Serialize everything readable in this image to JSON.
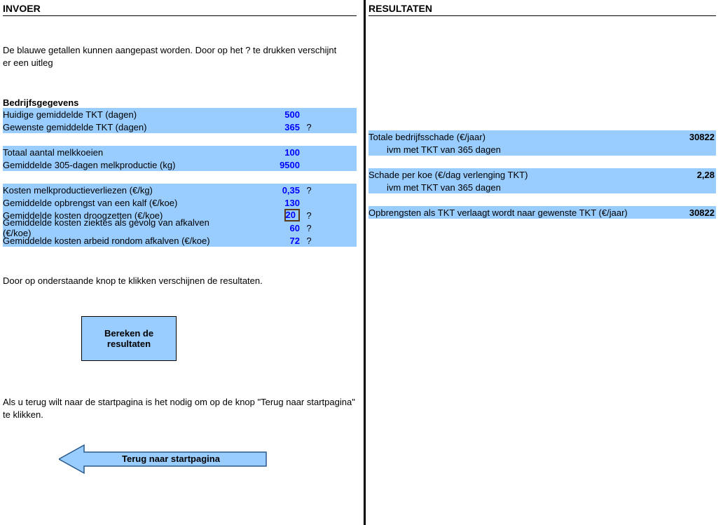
{
  "left": {
    "header": "INVOER",
    "intro": "De blauwe getallen kunnen aangepast worden. Door op het ? te drukken verschijnt er een uitleg",
    "section_title": "Bedrijfsgegevens",
    "rows": [
      {
        "label": "Huidige gemiddelde TKT (dagen)",
        "value": "500",
        "help": ""
      },
      {
        "label": "Gewenste gemiddelde TKT (dagen)",
        "value": "365",
        "help": "?"
      },
      {
        "label": "Totaal aantal melkkoeien",
        "value": "100",
        "help": ""
      },
      {
        "label": "Gemiddelde 305-dagen melkproductie (kg)",
        "value": "9500",
        "help": ""
      },
      {
        "label": "Kosten melkproductieverliezen (€/kg)",
        "value": "0,35",
        "help": "?"
      },
      {
        "label": "Gemiddelde opbrengst van een kalf (€/koe)",
        "value": "130",
        "help": ""
      },
      {
        "label": "Gemiddelde kosten droogzetten (€/koe)",
        "value": "20",
        "help": "?"
      },
      {
        "label": "Gemiddelde kosten ziektes als gevolg van afkalven (€/koe)",
        "value": "60",
        "help": "?"
      },
      {
        "label": "Gemiddelde kosten arbeid rondom afkalven (€/koe)",
        "value": "72",
        "help": "?"
      }
    ],
    "calc_button": "Bereken de resultaten",
    "mid_text": "Door op onderstaande knop te klikken verschijnen de resultaten.",
    "back_text": "Als u terug wilt naar de startpagina is het nodig om op de knop \"Terug naar startpagina\" te klikken.",
    "back_button": "Terug naar startpagina"
  },
  "right": {
    "header": "RESULTATEN",
    "rows": [
      {
        "label": "Totale bedrijfsschade (€/jaar)",
        "value": "30822"
      },
      {
        "label_indent": "ivm met TKT van 365 dagen",
        "value": ""
      },
      {
        "label": "Schade per koe (€/dag verlenging TKT)",
        "value": "2,28"
      },
      {
        "label_indent": "ivm met TKT van 365 dagen",
        "value": ""
      },
      {
        "label": "Opbrengsten als TKT verlaagt wordt naar gewenste TKT (€/jaar)",
        "value": "30822"
      }
    ]
  }
}
